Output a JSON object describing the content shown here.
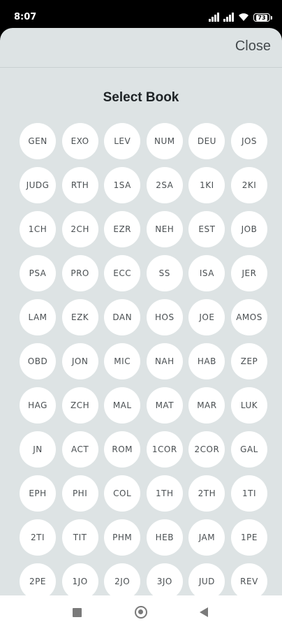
{
  "status_bar": {
    "time": "8:07",
    "battery": "73",
    "icons": [
      "signal-icon",
      "signal-icon",
      "wifi-icon",
      "battery-icon"
    ]
  },
  "sheet": {
    "close_label": "Close",
    "title": "Select Book",
    "background_color": "#dde3e4"
  },
  "books": [
    "GEN",
    "EXO",
    "LEV",
    "NUM",
    "DEU",
    "JOS",
    "JUDG",
    "RTH",
    "1SA",
    "2SA",
    "1KI",
    "2KI",
    "1CH",
    "2CH",
    "EZR",
    "NEH",
    "EST",
    "JOB",
    "PSA",
    "PRO",
    "ECC",
    "SS",
    "ISA",
    "JER",
    "LAM",
    "EZK",
    "DAN",
    "HOS",
    "JOE",
    "AMOS",
    "OBD",
    "JON",
    "MIC",
    "NAH",
    "HAB",
    "ZEP",
    "HAG",
    "ZCH",
    "MAL",
    "MAT",
    "MAR",
    "LUK",
    "JN",
    "ACT",
    "ROM",
    "1COR",
    "2COR",
    "GAL",
    "EPH",
    "PHI",
    "COL",
    "1TH",
    "2TH",
    "1TI",
    "2TI",
    "TIT",
    "PHM",
    "HEB",
    "JAM",
    "1PE",
    "2PE",
    "1JO",
    "2JO",
    "3JO",
    "JUD",
    "REV"
  ],
  "nav_bar": {
    "buttons": [
      "recents-icon",
      "home-icon",
      "back-icon"
    ]
  }
}
